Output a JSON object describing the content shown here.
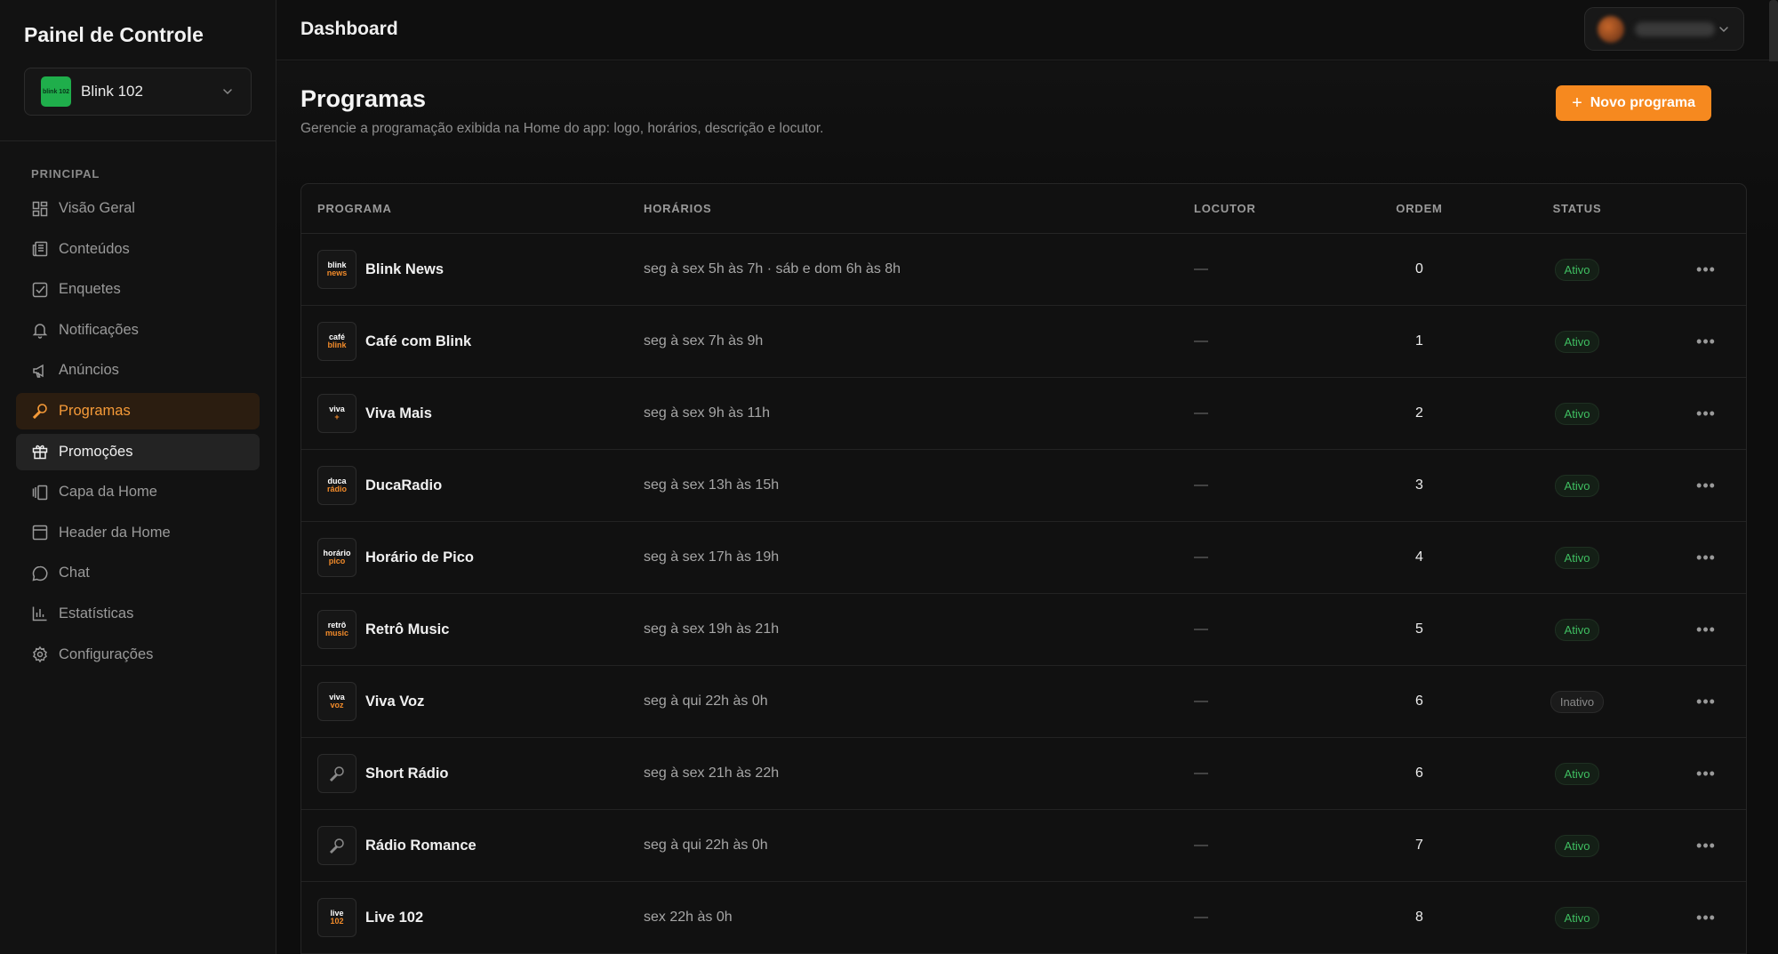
{
  "sidebar": {
    "brand": "Painel de Controle",
    "station": {
      "name": "Blink 102",
      "logo_text": "blink 102"
    },
    "section_label": "PRINCIPAL",
    "items": [
      {
        "label": "Visão Geral",
        "icon": "grid-icon"
      },
      {
        "label": "Conteúdos",
        "icon": "newspaper-icon"
      },
      {
        "label": "Enquetes",
        "icon": "checkbox-icon"
      },
      {
        "label": "Notificações",
        "icon": "bell-icon"
      },
      {
        "label": "Anúncios",
        "icon": "megaphone-icon"
      },
      {
        "label": "Programas",
        "icon": "microphone-icon"
      },
      {
        "label": "Promoções",
        "icon": "gift-icon"
      },
      {
        "label": "Capa da Home",
        "icon": "gallery-icon"
      },
      {
        "label": "Header da Home",
        "icon": "layout-icon"
      },
      {
        "label": "Chat",
        "icon": "chat-icon"
      },
      {
        "label": "Estatísticas",
        "icon": "bar-chart-icon"
      },
      {
        "label": "Configurações",
        "icon": "gear-icon"
      }
    ]
  },
  "topbar": {
    "title": "Dashboard"
  },
  "page": {
    "title": "Programas",
    "description": "Gerencie a programação exibida na Home do app: logo, horários, descrição e locutor.",
    "new_button": "Novo programa"
  },
  "table": {
    "headers": {
      "programa": "PROGRAMA",
      "horarios": "HORÁRIOS",
      "locutor": "LOCUTOR",
      "ordem": "ORDEM",
      "status": "STATUS"
    },
    "rows": [
      {
        "name": "Blink News",
        "horarios": "seg à sex 5h às 7h · sáb e dom 6h às 8h",
        "locutor": "—",
        "ordem": "0",
        "status": "Ativo",
        "logo": [
          "blink",
          "news"
        ]
      },
      {
        "name": "Café com Blink",
        "horarios": "seg à sex 7h às 9h",
        "locutor": "—",
        "ordem": "1",
        "status": "Ativo",
        "logo": [
          "café",
          "blink"
        ]
      },
      {
        "name": "Viva Mais",
        "horarios": "seg à sex 9h às 11h",
        "locutor": "—",
        "ordem": "2",
        "status": "Ativo",
        "logo": [
          "viva",
          "+"
        ]
      },
      {
        "name": "DucaRadio",
        "horarios": "seg à sex 13h às 15h",
        "locutor": "—",
        "ordem": "3",
        "status": "Ativo",
        "logo": [
          "duca",
          "rádio"
        ]
      },
      {
        "name": "Horário de Pico",
        "horarios": "seg à sex 17h às 19h",
        "locutor": "—",
        "ordem": "4",
        "status": "Ativo",
        "logo": [
          "horário",
          "pico"
        ]
      },
      {
        "name": "Retrô Music",
        "horarios": "seg à sex 19h às 21h",
        "locutor": "—",
        "ordem": "5",
        "status": "Ativo",
        "logo": [
          "retrô",
          "music"
        ]
      },
      {
        "name": "Viva Voz",
        "horarios": "seg à qui 22h às 0h",
        "locutor": "—",
        "ordem": "6",
        "status": "Inativo",
        "logo": [
          "viva",
          "voz"
        ]
      },
      {
        "name": "Short Rádio",
        "horarios": "seg à sex 21h às 22h",
        "locutor": "—",
        "ordem": "6",
        "status": "Ativo",
        "logo": null
      },
      {
        "name": "Rádio Romance",
        "horarios": "seg à qui 22h às 0h",
        "locutor": "—",
        "ordem": "7",
        "status": "Ativo",
        "logo": null
      },
      {
        "name": "Live 102",
        "horarios": "sex 22h às 0h",
        "locutor": "—",
        "ordem": "8",
        "status": "Ativo",
        "logo": [
          "live",
          "102"
        ]
      }
    ]
  }
}
